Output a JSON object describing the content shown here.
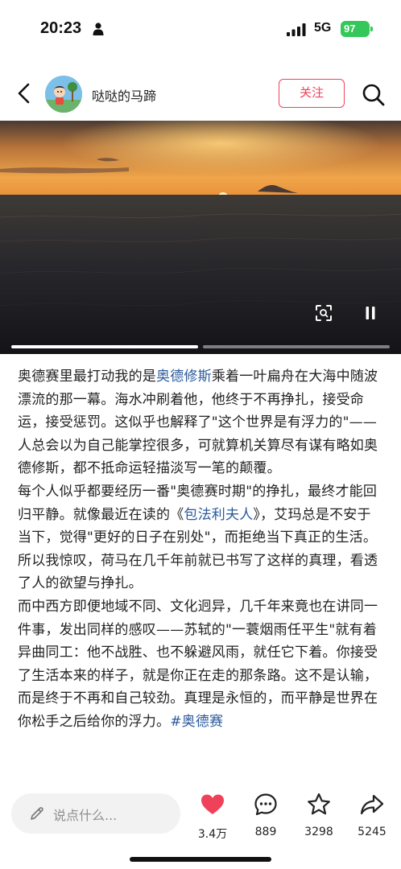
{
  "status_bar": {
    "time": "20:23",
    "network": "5G",
    "battery": "97"
  },
  "header": {
    "back_icon": "chevron-left-icon",
    "author_name": "哒哒的马蹄",
    "follow_label": "关注",
    "search_icon": "search-icon"
  },
  "image": {
    "description_icon_left": "scan-icon",
    "description_icon_right": "pause-icon",
    "progress_segments": 2,
    "progress_active_index": 0
  },
  "post": {
    "p1_a": "奥德赛里最打动我的是",
    "p1_link": "奥德修斯",
    "p1_b": "乘着一叶扁舟在大海中随波漂流的那一幕。海水冲刷着他，他终于不再挣扎，接受命运，接受惩罚。这似乎也解释了\"这个世界是有浮力的\"——人总会以为自己能掌控很多，可就算机关算尽有谋有略如奥德修斯，都不抵命运轻描淡写一笔的颠覆。",
    "p2_a": "每个人似乎都要经历一番\"奥德赛时期\"的挣扎，最终才能回归平静。就像最近在读的《",
    "p2_link": "包法利夫人",
    "p2_b": "》，艾玛总是不安于当下，觉得\"更好的日子在别处\"，而拒绝当下真正的生活。",
    "p3": "所以我惊叹，荷马在几千年前就已书写了这样的真理，看透了人的欲望与挣扎。",
    "p4": "而中西方即便地域不同、文化迥异，几千年来竟也在讲同一件事，发出同样的感叹——苏轼的\"一蓑烟雨任平生\"就有着异曲同工：他不战胜、也不躲避风雨，就任它下着。你接受了生活本来的样子，就是你正在走的那条路。这不是认输，而是终于不再和自己较劲。真理是永恒的，而平静是世界在你松手之后给你的浮力。",
    "hashtag": "#奥德赛"
  },
  "bottom_bar": {
    "comment_placeholder": "说点什么...",
    "like_count": "3.4万",
    "comment_count": "889",
    "star_count": "3298",
    "share_count": "5245"
  },
  "colors": {
    "accent": "#f0415a",
    "link": "#2a5a9c",
    "battery": "#34c759"
  }
}
